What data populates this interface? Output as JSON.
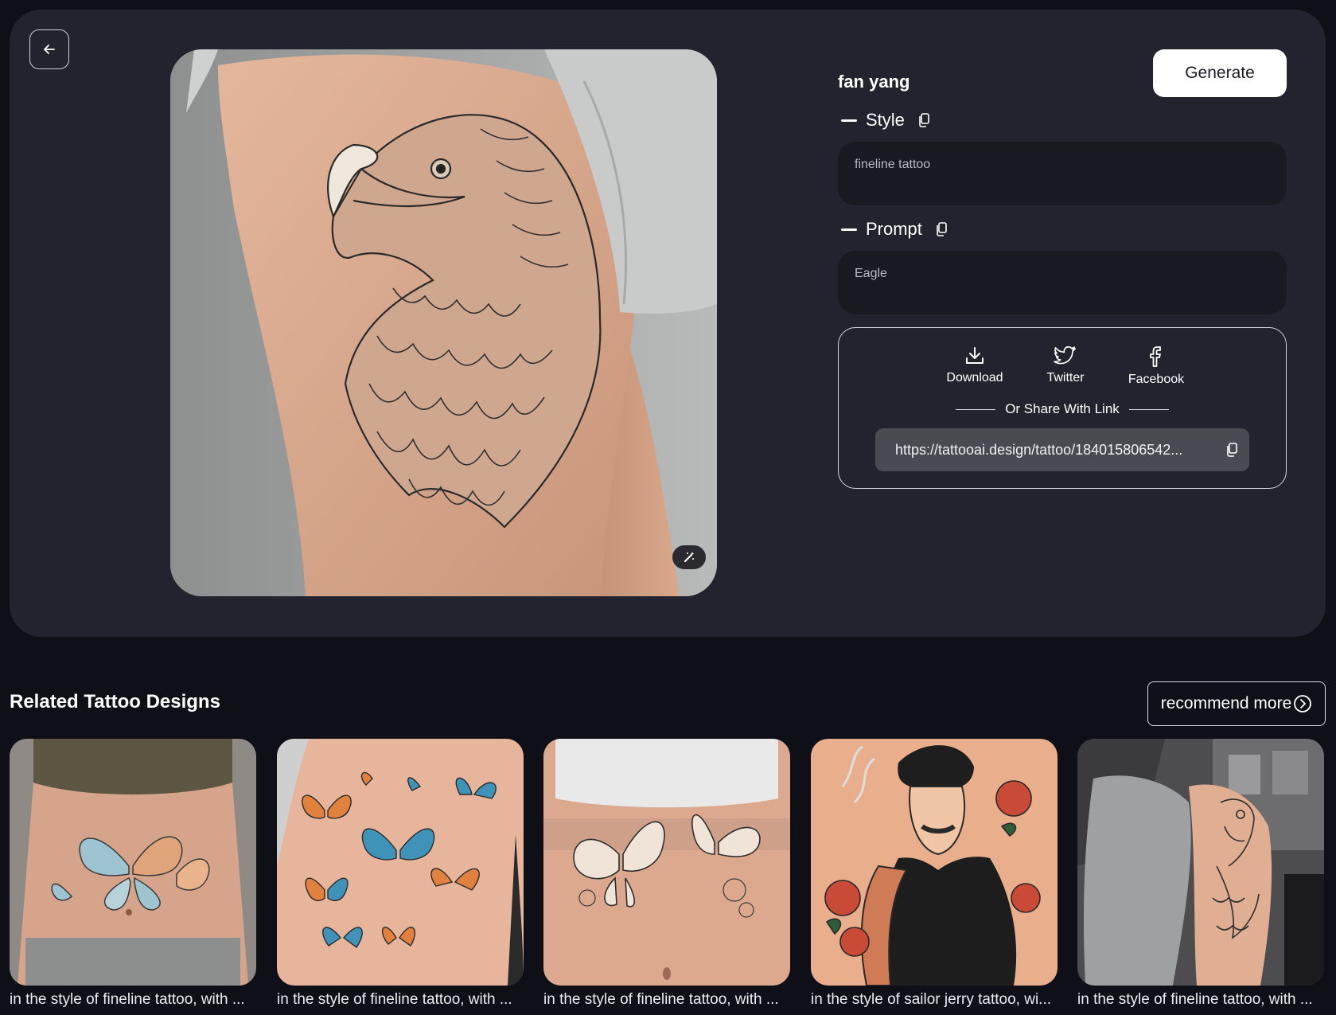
{
  "author": {
    "name": "fan yang"
  },
  "actions": {
    "generate_label": "Generate"
  },
  "style_section": {
    "label": "Style",
    "value": "fineline tattoo"
  },
  "prompt_section": {
    "label": "Prompt",
    "value": "Eagle"
  },
  "share": {
    "download_label": "Download",
    "twitter_label": "Twitter",
    "facebook_label": "Facebook",
    "divider_label": "Or Share With Link",
    "link": "https://tattooai.design/tattoo/184015806542..."
  },
  "related": {
    "title": "Related Tattoo Designs",
    "recommend_label": "recommend more",
    "items": [
      {
        "caption": "in the style of fineline tattoo, with ..."
      },
      {
        "caption": "in the style of fineline tattoo, with ..."
      },
      {
        "caption": "in the style of fineline tattoo, with ..."
      },
      {
        "caption": "in the style of sailor jerry tattoo, wi..."
      },
      {
        "caption": "in the style of fineline tattoo, with ..."
      }
    ]
  },
  "colors": {
    "page_bg": "#0f0f17",
    "card_bg": "#23232f",
    "field_bg": "#191921",
    "link_bg": "#4a4a53"
  }
}
